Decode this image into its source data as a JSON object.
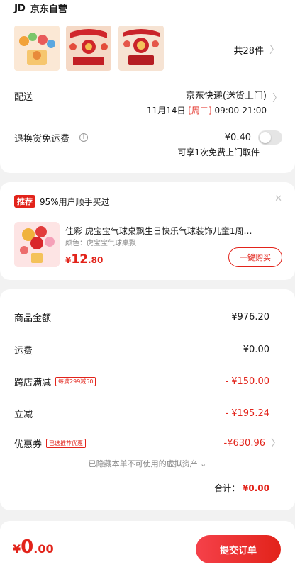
{
  "store": {
    "logo": "JD",
    "name": "京东自营"
  },
  "products": {
    "count_label": "共28件"
  },
  "delivery": {
    "label": "配送",
    "carrier": "京东快递(送货上门)",
    "date": "11月14日",
    "weekday": "[周二]",
    "time_window": "09:00-21:00"
  },
  "return_insurance": {
    "label": "退换货免运费",
    "info_icon": "info-icon",
    "price": "¥0.40",
    "desc": "可享1次免费上门取件",
    "enabled": false
  },
  "recommend": {
    "tag": "推荐",
    "headline": "95%用户顺手买过",
    "title": "佳彩 虎宝宝气球桌飘生日快乐气球装饰儿童1周…",
    "spec": "颜色：虎宝宝气球桌飘",
    "price_symbol": "¥",
    "price_int": "12",
    "price_dec": ".80",
    "buy_label": "一键购买"
  },
  "summary": {
    "goods_label": "商品金额",
    "goods_value": "¥976.20",
    "shipping_label": "运费",
    "shipping_value": "¥0.00",
    "cross_store_label": "跨店满减",
    "cross_store_badge": "每满299减50",
    "cross_store_value": "- ¥150.00",
    "instant_label": "立减",
    "instant_value": "- ¥195.24",
    "coupon_label": "优惠券",
    "coupon_badge": "已选推荐优惠",
    "coupon_value": "-¥630.96",
    "hidden_note": "已隐藏本单不可使用的虚拟资产",
    "subtotal_label": "合计：",
    "subtotal_value": "¥0.00"
  },
  "bottom": {
    "symbol": "¥",
    "int": "0",
    "dec": ".00",
    "submit_label": "提交订单"
  },
  "colors": {
    "accent": "#e2231a",
    "background": "#f2f2f2"
  }
}
